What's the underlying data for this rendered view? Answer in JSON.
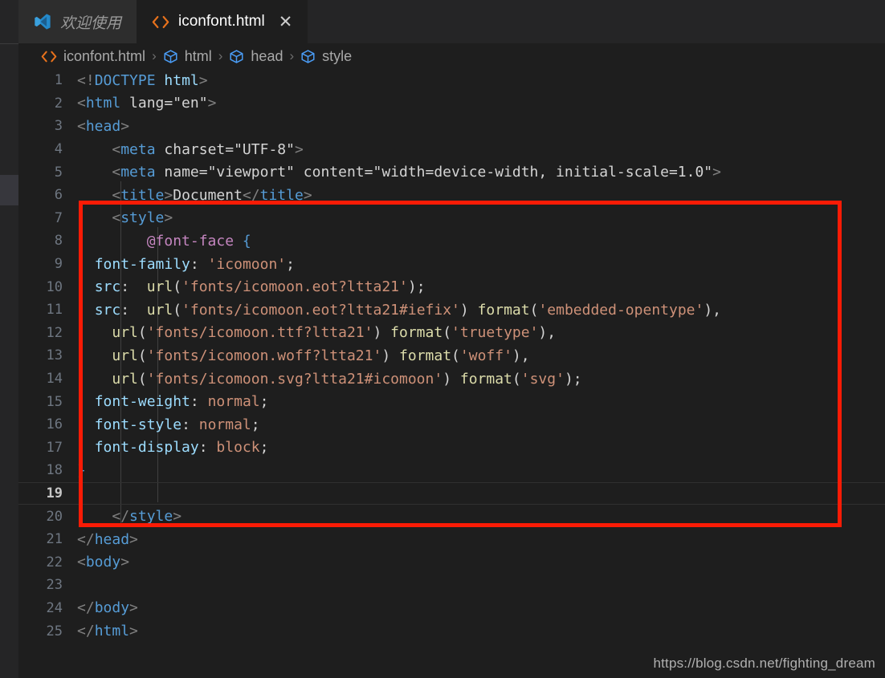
{
  "window": {
    "app": "Visual Studio Code",
    "theme_bg": "#1e1e1e",
    "accent": "#569cd6",
    "annotation_color": "#fa1b05"
  },
  "tabs": [
    {
      "label": "欢迎使用",
      "icon": "vscode-logo-icon",
      "active": false,
      "closable": false
    },
    {
      "label": "iconfont.html",
      "icon": "html-code-icon",
      "active": true,
      "closable": true,
      "close_label": "✕"
    }
  ],
  "breadcrumb": {
    "separator": "›",
    "items": [
      {
        "label": "iconfont.html",
        "icon": "html-code-icon"
      },
      {
        "label": "html",
        "icon": "symbol-cube-icon"
      },
      {
        "label": "head",
        "icon": "symbol-cube-icon"
      },
      {
        "label": "style",
        "icon": "symbol-cube-icon"
      }
    ]
  },
  "editor": {
    "language": "html",
    "current_line": 19,
    "line_numbers": [
      1,
      2,
      3,
      4,
      5,
      6,
      7,
      8,
      9,
      10,
      11,
      12,
      13,
      14,
      15,
      16,
      17,
      18,
      19,
      20,
      21,
      22,
      23,
      24,
      25
    ],
    "lines": [
      {
        "n": 1,
        "text": "<!DOCTYPE html>"
      },
      {
        "n": 2,
        "text": "<html lang=\"en\">"
      },
      {
        "n": 3,
        "text": "<head>"
      },
      {
        "n": 4,
        "text": "    <meta charset=\"UTF-8\">"
      },
      {
        "n": 5,
        "text": "    <meta name=\"viewport\" content=\"width=device-width, initial-scale=1.0\">"
      },
      {
        "n": 6,
        "text": "    <title>Document</title>"
      },
      {
        "n": 7,
        "text": "    <style>"
      },
      {
        "n": 8,
        "text": "        @font-face {"
      },
      {
        "n": 9,
        "text": "  font-family: 'icomoon';"
      },
      {
        "n": 10,
        "text": "  src:  url('fonts/icomoon.eot?ltta21');"
      },
      {
        "n": 11,
        "text": "  src:  url('fonts/icomoon.eot?ltta21#iefix') format('embedded-opentype'),"
      },
      {
        "n": 12,
        "text": "    url('fonts/icomoon.ttf?ltta21') format('truetype'),"
      },
      {
        "n": 13,
        "text": "    url('fonts/icomoon.woff?ltta21') format('woff'),"
      },
      {
        "n": 14,
        "text": "    url('fonts/icomoon.svg?ltta21#icomoon') format('svg');"
      },
      {
        "n": 15,
        "text": "  font-weight: normal;"
      },
      {
        "n": 16,
        "text": "  font-style: normal;"
      },
      {
        "n": 17,
        "text": "  font-display: block;"
      },
      {
        "n": 18,
        "text": "}"
      },
      {
        "n": 19,
        "text": ""
      },
      {
        "n": 20,
        "text": "    </style>"
      },
      {
        "n": 21,
        "text": "</head>"
      },
      {
        "n": 22,
        "text": "<body>"
      },
      {
        "n": 23,
        "text": ""
      },
      {
        "n": 24,
        "text": "</body>"
      },
      {
        "n": 25,
        "text": "</html>"
      }
    ]
  },
  "annotation": {
    "type": "rectangle",
    "color": "#fa1b05",
    "covers_lines": "7-20"
  },
  "watermark": {
    "text": "https://blog.csdn.net/fighting_dream"
  }
}
